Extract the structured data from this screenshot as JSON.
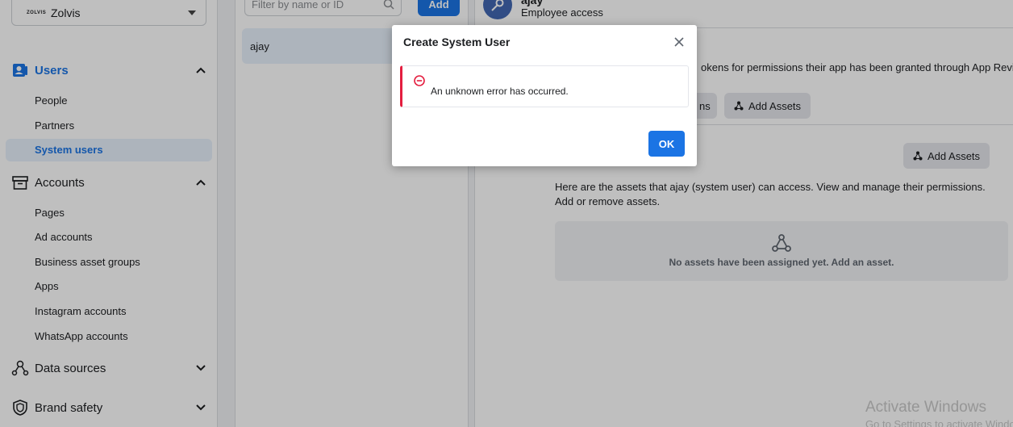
{
  "business": {
    "logo_text": "ZOLVIS",
    "name": "Zolvis"
  },
  "sidebar": {
    "users": {
      "label": "Users",
      "items": [
        "People",
        "Partners",
        "System users"
      ]
    },
    "accounts": {
      "label": "Accounts",
      "items": [
        "Pages",
        "Ad accounts",
        "Business asset groups",
        "Apps",
        "Instagram accounts",
        "WhatsApp accounts"
      ]
    },
    "data_sources": {
      "label": "Data sources"
    },
    "brand_safety": {
      "label": "Brand safety"
    }
  },
  "list_panel": {
    "filter_placeholder": "Filter by name or ID",
    "add_label": "Add",
    "selected_user": "ajay"
  },
  "detail": {
    "user_name": "ajay",
    "user_role": "Employee access",
    "token_text": "okens for permissions their app has been granted through App Review.",
    "partial_button_label": "ns",
    "add_assets_label": "Add Assets",
    "description": "Here are the assets that ajay (system user) can access. View and manage their permissions. Add or remove assets.",
    "empty_text": "No assets have been assigned yet. Add an asset."
  },
  "modal": {
    "title": "Create System User",
    "error_message": "An unknown error has occurred.",
    "ok_label": "OK"
  },
  "watermark": {
    "line1": "Activate Windows",
    "line2": "Go to Settings to activate Windows."
  },
  "colors": {
    "accent": "#1b74e4",
    "error": "#e41e3f"
  }
}
